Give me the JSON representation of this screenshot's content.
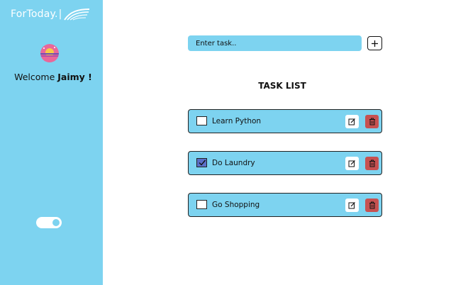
{
  "app": {
    "brand": "ForToday.",
    "brand_separator": "|",
    "logo_icon": "wing-logo-icon",
    "avatar_icon": "sunset-avatar-icon"
  },
  "sidebar": {
    "welcome_prefix": "Welcome",
    "user_name": "Jaimy !",
    "theme_toggle_on": true,
    "background": "#7dd3f0"
  },
  "main": {
    "input_placeholder": "Enter task..",
    "add_icon": "plus-icon",
    "list_title": "TASK LIST",
    "tasks": [
      {
        "label": "Learn Python",
        "done": false
      },
      {
        "label": "Do Laundry",
        "done": true
      },
      {
        "label": "Go Shopping",
        "done": false
      }
    ],
    "edit_icon": "edit-icon",
    "delete_icon": "trash-icon",
    "colors": {
      "task_bg": "#7dd3f0",
      "delete_bg": "#c75151",
      "check_bg": "#5b6ec7"
    }
  }
}
